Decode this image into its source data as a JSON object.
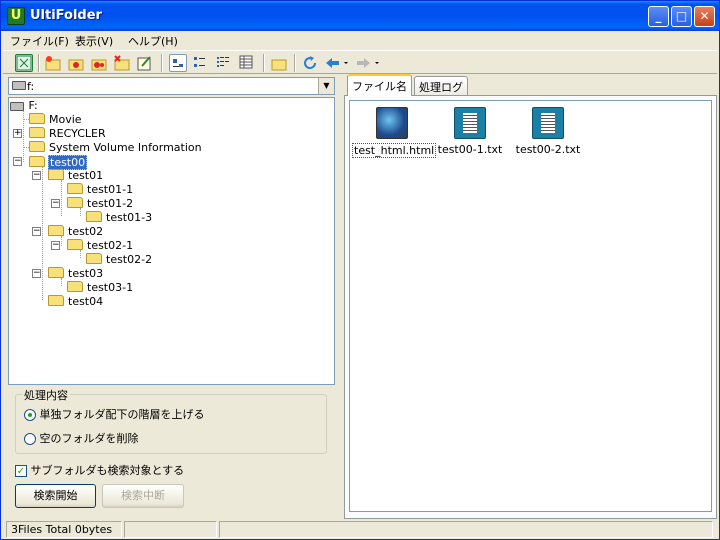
{
  "window": {
    "title": "UltiFolder",
    "app_icon_letter": "U"
  },
  "caption_buttons": {
    "minimize": "_",
    "maximize": "□",
    "close": "✕"
  },
  "menu": [
    {
      "label": "ファイル(F)"
    },
    {
      "label": "表示(V)"
    },
    {
      "label": "ヘルプ(H)"
    }
  ],
  "toolbar": {
    "icons": [
      "app-icon",
      "new-folder-icon",
      "copy-folder-icon",
      "move-folder-icon",
      "delete-folder-icon",
      "rename-icon",
      "large-icons-view-icon",
      "small-icons-view-icon",
      "list-view-icon",
      "details-view-icon",
      "folder-up-icon",
      "refresh-icon",
      "back-icon",
      "forward-icon"
    ]
  },
  "drive_selector": {
    "value": "f:"
  },
  "tree": {
    "root": "F:",
    "items": [
      {
        "label": "Movie"
      },
      {
        "label": "RECYCLER"
      },
      {
        "label": "System Volume Information"
      },
      {
        "label": "test00"
      },
      {
        "label": "test01"
      },
      {
        "label": "test01-1"
      },
      {
        "label": "test01-2"
      },
      {
        "label": "test01-3"
      },
      {
        "label": "test02"
      },
      {
        "label": "test02-1"
      },
      {
        "label": "test02-2"
      },
      {
        "label": "test03"
      },
      {
        "label": "test03-1"
      },
      {
        "label": "test04"
      }
    ]
  },
  "options": {
    "group_title": "処理内容",
    "radio1": "単独フォルダ配下の階層を上げる",
    "radio2": "空のフォルダを削除",
    "checkbox": "サブフォルダも検索対象とする",
    "checkbox_mark": "✓",
    "start_button": "検索開始",
    "stop_button": "検索中断"
  },
  "tabs": {
    "files": "ファイル名",
    "log": "処理ログ"
  },
  "files": [
    {
      "name": "test_html.html"
    },
    {
      "name": "test00-1.txt"
    },
    {
      "name": "test00-2.txt"
    }
  ],
  "status": {
    "summary": "3Files  Total 0bytes"
  }
}
